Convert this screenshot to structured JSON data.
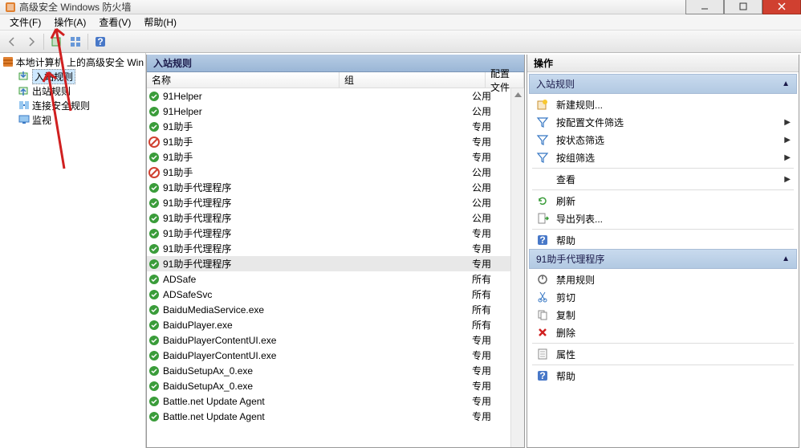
{
  "window": {
    "title": "高级安全 Windows 防火墙"
  },
  "menu": {
    "file": "文件(F)",
    "action": "操作(A)",
    "view": "查看(V)",
    "help": "帮助(H)"
  },
  "tree": {
    "root": "本地计算机 上的高级安全 Win",
    "items": [
      {
        "id": "inbound",
        "label": "入站规则",
        "icon": "inbound",
        "selected": true
      },
      {
        "id": "outbound",
        "label": "出站规则",
        "icon": "outbound"
      },
      {
        "id": "connsec",
        "label": "连接安全规则",
        "icon": "connsec"
      },
      {
        "id": "monitor",
        "label": "监视",
        "icon": "monitor"
      }
    ]
  },
  "center": {
    "title": "入站规则",
    "columns": {
      "name": "名称",
      "group": "组",
      "profile": "配置文件"
    },
    "rules": [
      {
        "icon": "allow",
        "name": "91Helper",
        "profile": "公用"
      },
      {
        "icon": "allow",
        "name": "91Helper",
        "profile": "公用"
      },
      {
        "icon": "allow",
        "name": "91助手",
        "profile": "专用"
      },
      {
        "icon": "block",
        "name": "91助手",
        "profile": "专用"
      },
      {
        "icon": "allow",
        "name": "91助手",
        "profile": "专用"
      },
      {
        "icon": "block",
        "name": "91助手",
        "profile": "公用"
      },
      {
        "icon": "allow",
        "name": "91助手代理程序",
        "profile": "公用"
      },
      {
        "icon": "allow",
        "name": "91助手代理程序",
        "profile": "公用"
      },
      {
        "icon": "allow",
        "name": "91助手代理程序",
        "profile": "公用"
      },
      {
        "icon": "allow",
        "name": "91助手代理程序",
        "profile": "专用"
      },
      {
        "icon": "allow",
        "name": "91助手代理程序",
        "profile": "专用"
      },
      {
        "icon": "allow",
        "name": "91助手代理程序",
        "profile": "专用",
        "selected": true
      },
      {
        "icon": "allow",
        "name": "ADSafe",
        "profile": "所有"
      },
      {
        "icon": "allow",
        "name": "ADSafeSvc",
        "profile": "所有"
      },
      {
        "icon": "allow",
        "name": "BaiduMediaService.exe",
        "profile": "所有"
      },
      {
        "icon": "allow",
        "name": "BaiduPlayer.exe",
        "profile": "所有"
      },
      {
        "icon": "allow",
        "name": "BaiduPlayerContentUI.exe",
        "profile": "专用"
      },
      {
        "icon": "allow",
        "name": "BaiduPlayerContentUI.exe",
        "profile": "专用"
      },
      {
        "icon": "allow",
        "name": "BaiduSetupAx_0.exe",
        "profile": "专用"
      },
      {
        "icon": "allow",
        "name": "BaiduSetupAx_0.exe",
        "profile": "专用"
      },
      {
        "icon": "allow",
        "name": "Battle.net Update Agent",
        "profile": "专用"
      },
      {
        "icon": "allow",
        "name": "Battle.net Update Agent",
        "profile": "专用"
      }
    ]
  },
  "actions": {
    "header": "操作",
    "section1": "入站规则",
    "items1": [
      {
        "icon": "new",
        "label": "新建规则...",
        "id": "new-rule"
      },
      {
        "icon": "filter",
        "label": "按配置文件筛选",
        "arrow": true,
        "id": "filter-profile"
      },
      {
        "icon": "filter",
        "label": "按状态筛选",
        "arrow": true,
        "id": "filter-state"
      },
      {
        "icon": "filter",
        "label": "按组筛选",
        "arrow": true,
        "id": "filter-group"
      },
      {
        "sep": true
      },
      {
        "icon": "",
        "label": "查看",
        "arrow": true,
        "id": "view"
      },
      {
        "sep": true
      },
      {
        "icon": "refresh",
        "label": "刷新",
        "id": "refresh"
      },
      {
        "icon": "export",
        "label": "导出列表...",
        "id": "export"
      },
      {
        "sep": true
      },
      {
        "icon": "help",
        "label": "帮助",
        "id": "help1"
      }
    ],
    "section2": "91助手代理程序",
    "items2": [
      {
        "icon": "disable",
        "label": "禁用规则",
        "id": "disable"
      },
      {
        "icon": "cut",
        "label": "剪切",
        "id": "cut"
      },
      {
        "icon": "copy",
        "label": "复制",
        "id": "copy"
      },
      {
        "icon": "delete",
        "label": "删除",
        "id": "delete"
      },
      {
        "sep": true
      },
      {
        "icon": "props",
        "label": "属性",
        "id": "props"
      },
      {
        "sep": true
      },
      {
        "icon": "help",
        "label": "帮助",
        "id": "help2"
      }
    ]
  }
}
